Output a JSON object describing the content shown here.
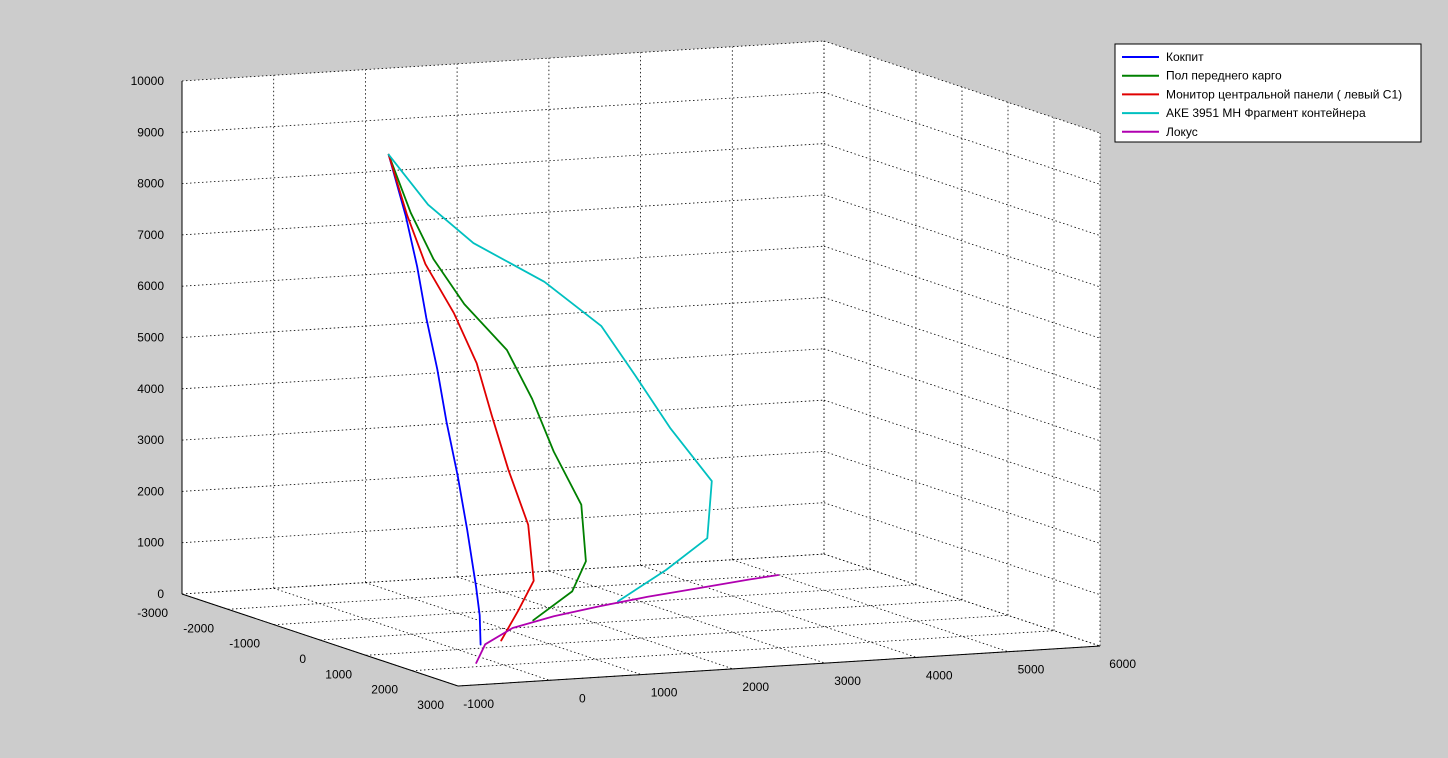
{
  "chart_data": {
    "type": "line",
    "projection": "3d",
    "grid": true,
    "legend_placement": "top-right",
    "axes": {
      "x": {
        "range": [
          -1000,
          6000
        ],
        "ticks": [
          -1000,
          0,
          1000,
          2000,
          3000,
          4000,
          5000,
          6000
        ]
      },
      "y": {
        "range": [
          -3000,
          3000
        ],
        "ticks": [
          -3000,
          -2000,
          -1000,
          0,
          1000,
          2000,
          3000
        ]
      },
      "z": {
        "range": [
          0,
          10000
        ],
        "ticks": [
          0,
          1000,
          2000,
          3000,
          4000,
          5000,
          6000,
          7000,
          8000,
          9000,
          10000
        ]
      }
    },
    "series": [
      {
        "name": "Кокпит",
        "color": "#0000ff",
        "points": [
          [
            0,
            -500,
            9200
          ],
          [
            170,
            -470,
            8000
          ],
          [
            280,
            -440,
            7000
          ],
          [
            370,
            -420,
            6000
          ],
          [
            470,
            -380,
            5000
          ],
          [
            520,
            -280,
            4000
          ],
          [
            560,
            -120,
            3000
          ],
          [
            560,
            90,
            2000
          ],
          [
            500,
            400,
            1000
          ],
          [
            440,
            600,
            500
          ],
          [
            350,
            800,
            0
          ]
        ]
      },
      {
        "name": "Пол переднего карго",
        "color": "#008000",
        "points": [
          [
            0,
            -500,
            9200
          ],
          [
            300,
            -620,
            8000
          ],
          [
            640,
            -800,
            7000
          ],
          [
            1100,
            -1050,
            6000
          ],
          [
            1640,
            -1200,
            5000
          ],
          [
            1940,
            -1250,
            4000
          ],
          [
            2100,
            -1100,
            3000
          ],
          [
            2300,
            -900,
            2000
          ],
          [
            2200,
            -600,
            1000
          ],
          [
            1950,
            -400,
            500
          ],
          [
            1500,
            -350,
            0
          ]
        ]
      },
      {
        "name": "Монитор центральной панели ( левый С1)",
        "color": "#e00000",
        "points": [
          [
            0,
            -500,
            9200
          ],
          [
            200,
            -500,
            8000
          ],
          [
            430,
            -560,
            7000
          ],
          [
            760,
            -600,
            6000
          ],
          [
            1000,
            -580,
            5000
          ],
          [
            1100,
            -450,
            4000
          ],
          [
            1180,
            -250,
            3000
          ],
          [
            1260,
            20,
            2000
          ],
          [
            1180,
            300,
            1000
          ],
          [
            920,
            480,
            500
          ],
          [
            650,
            650,
            0
          ]
        ]
      },
      {
        "name": "АКЕ 3951 МН Фрагмент контейнера",
        "color": "#00c0c0",
        "points": [
          [
            0,
            -500,
            9200
          ],
          [
            680,
            -1000,
            8000
          ],
          [
            1450,
            -1550,
            7000
          ],
          [
            2450,
            -2000,
            6000
          ],
          [
            3170,
            -2200,
            5000
          ],
          [
            3520,
            -2150,
            4000
          ],
          [
            3820,
            -2000,
            3000
          ],
          [
            4150,
            -1750,
            2000
          ],
          [
            3950,
            -1450,
            1000
          ],
          [
            3400,
            -1250,
            500
          ],
          [
            2800,
            -1100,
            0
          ]
        ]
      },
      {
        "name": "Локус",
        "color": "#b000b0",
        "points": [
          [
            -200,
            1800,
            0
          ],
          [
            400,
            800,
            0
          ],
          [
            1100,
            0,
            0
          ],
          [
            1800,
            -500,
            0
          ],
          [
            2500,
            -900,
            0
          ],
          [
            3200,
            -1250,
            0
          ],
          [
            3900,
            -1550,
            0
          ],
          [
            4600,
            -1850,
            0
          ],
          [
            5000,
            -2000,
            0
          ]
        ]
      }
    ]
  }
}
